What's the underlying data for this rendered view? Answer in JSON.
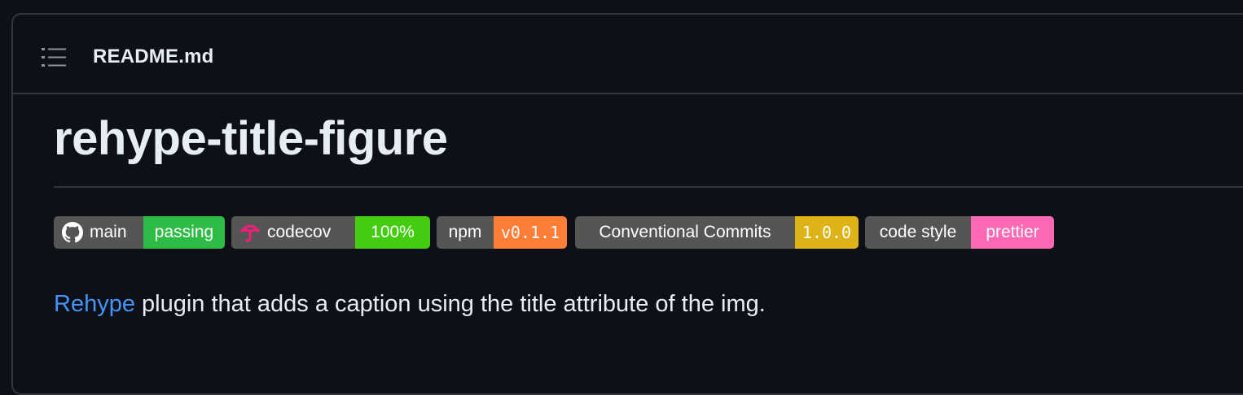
{
  "header": {
    "filename": "README.md",
    "outline_icon": "list-unordered-icon"
  },
  "readme": {
    "title": "rehype-title-figure",
    "badges": [
      {
        "left": "main",
        "right": "passing",
        "icon": "github-icon",
        "right_color": "#2fbc46"
      },
      {
        "left": "codecov",
        "right": "100%",
        "icon": "codecov-umbrella-icon",
        "right_color": "#44cc11"
      },
      {
        "left": "npm",
        "right": "v0.1.1",
        "icon": "",
        "right_color": "#fe7d37"
      },
      {
        "left": "Conventional Commits",
        "right": "1.0.0",
        "icon": "",
        "right_color": "#dfb317"
      },
      {
        "left": "code style",
        "right": "prettier",
        "icon": "",
        "right_color": "#ff69b4"
      }
    ],
    "description_link": "Rehype",
    "description_text": " plugin that adds a caption using the title attribute of the img."
  },
  "colors": {
    "background": "#0d1117",
    "border": "#30363d",
    "text": "#e6edf3",
    "link": "#4493f8",
    "badge_left": "#555555"
  }
}
